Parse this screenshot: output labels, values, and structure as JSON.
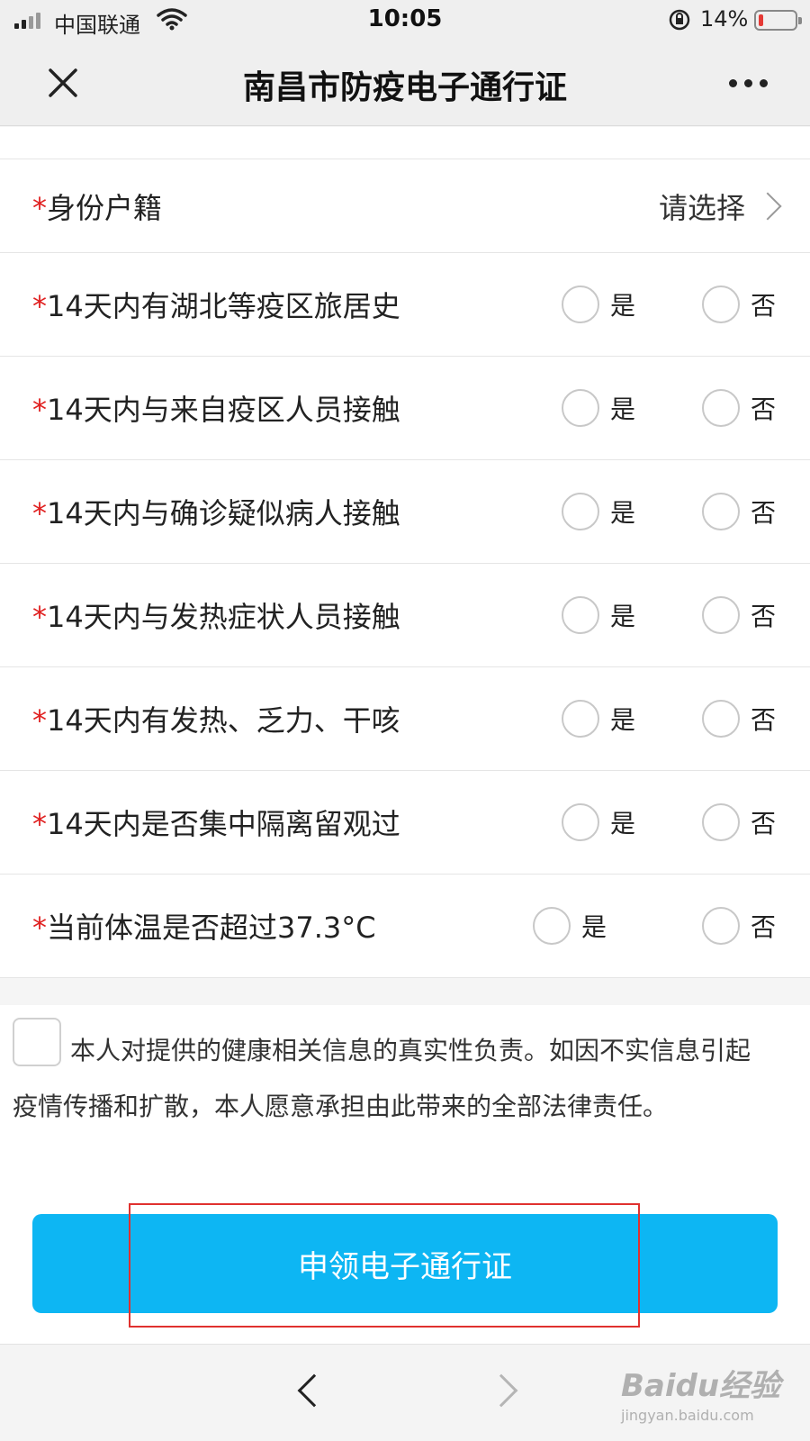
{
  "status_bar": {
    "carrier": "中国联通",
    "time": "10:05",
    "battery_percent": "14%",
    "battery_level": 0.14,
    "battery_color": "#e53935"
  },
  "nav": {
    "title": "南昌市防疫电子通行证",
    "close_icon": "close-icon",
    "more_icon": "more-icon"
  },
  "form": {
    "required_mark": "*",
    "identity": {
      "label": "身份户籍",
      "placeholder": "请选择"
    },
    "options": {
      "yes": "是",
      "no": "否"
    },
    "questions": [
      "14天内有湖北等疫区旅居史",
      "14天内与来自疫区人员接触",
      "14天内与确诊疑似病人接触",
      "14天内与发热症状人员接触",
      "14天内有发热、乏力、干咳",
      "14天内是否集中隔离留观过",
      "当前体温是否超过37.3°C"
    ]
  },
  "declaration": {
    "checked": false,
    "text": "本人对提供的健康相关信息的真实性负责。如因不实信息引起疫情传播和扩散，本人愿意承担由此带来的全部法律责任。"
  },
  "submit": {
    "label": "申领电子通行证",
    "color": "#0db6f3",
    "highlight_color": "#e0312f"
  },
  "bottom_nav": {
    "back_icon": "chevron-left-icon",
    "forward_icon": "chevron-right-icon"
  },
  "watermark": {
    "brand": "Baidu经验",
    "site": "jingyan.baidu.com"
  }
}
